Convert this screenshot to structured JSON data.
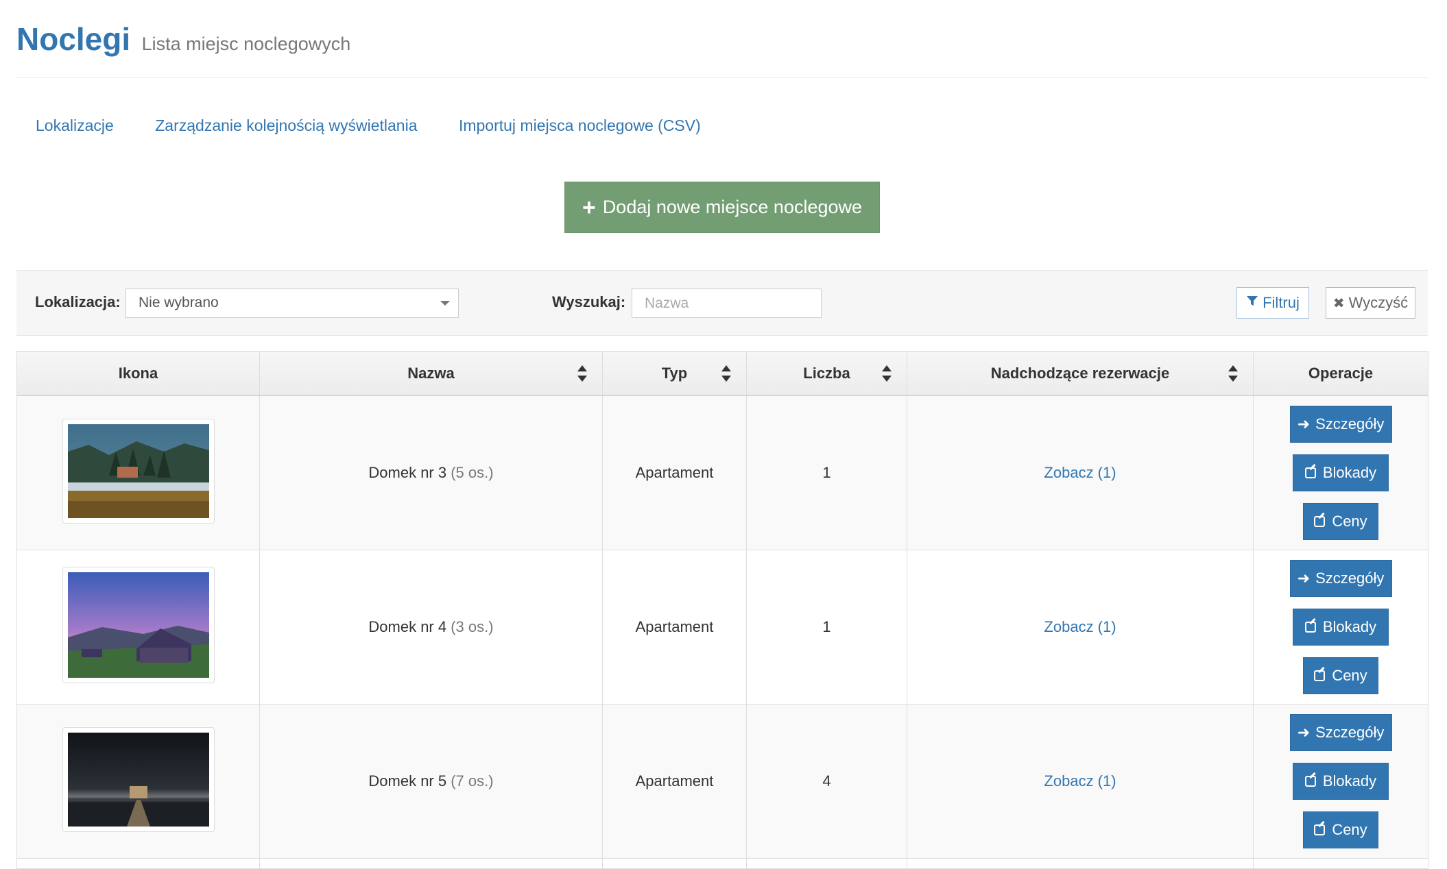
{
  "header": {
    "title": "Noclegi",
    "subtitle": "Lista miejsc noclegowych"
  },
  "links": [
    {
      "label": "Lokalizacje"
    },
    {
      "label": "Zarządzanie kolejnością wyświetlania"
    },
    {
      "label": "Importuj miejsca noclegowe (CSV)"
    }
  ],
  "add_button": {
    "label": "Dodaj nowe miejsce noclegowe"
  },
  "filters": {
    "location_label": "Lokalizacja:",
    "location_value": "Nie wybrano",
    "search_label": "Wyszukaj:",
    "search_placeholder": "Nazwa",
    "filter_button": "Filtruj",
    "clear_button": "Wyczyść"
  },
  "table": {
    "columns": [
      "Ikona",
      "Nazwa",
      "Typ",
      "Liczba",
      "Nadchodzące rezerwacje",
      "Operacje"
    ],
    "rows": [
      {
        "name": "Domek nr 3",
        "capacity": "(5 os.)",
        "type": "Apartament",
        "count": "1",
        "reservations": "Zobacz (1)"
      },
      {
        "name": "Domek nr 4",
        "capacity": "(3 os.)",
        "type": "Apartament",
        "count": "1",
        "reservations": "Zobacz (1)"
      },
      {
        "name": "Domek nr 5",
        "capacity": "(7 os.)",
        "type": "Apartament",
        "count": "4",
        "reservations": "Zobacz (1)"
      }
    ],
    "operations": {
      "details": "Szczegóły",
      "blocks": "Blokady",
      "prices": "Ceny"
    }
  },
  "colors": {
    "primary": "#3276b1",
    "success": "#739e73",
    "header_bg": "#f6f6f6"
  }
}
